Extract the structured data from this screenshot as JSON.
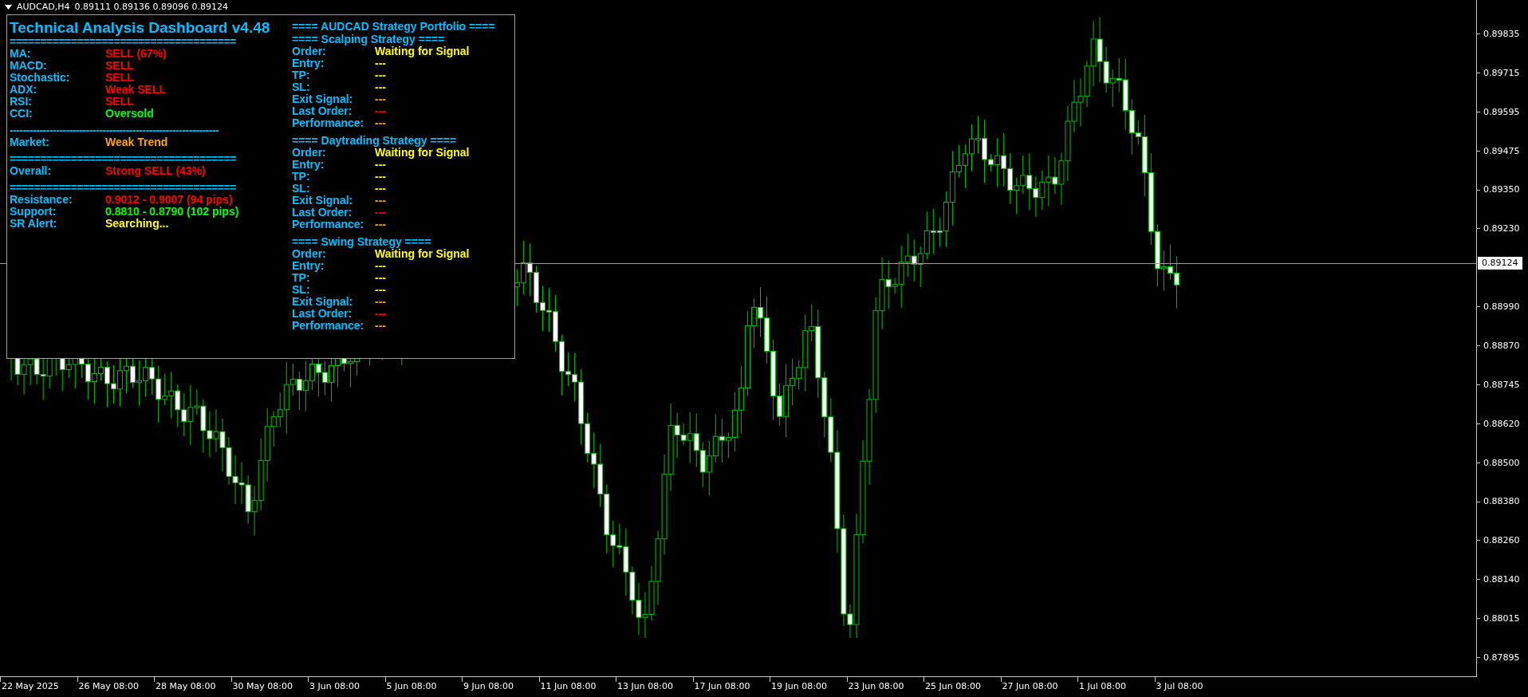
{
  "chart": {
    "header": {
      "symbol": "AUDCAD,H4",
      "quotes": "0.89111 0.89136 0.89096 0.89124"
    },
    "price_axis": [
      "0.89835",
      "0.89715",
      "0.89595",
      "0.89475",
      "0.89350",
      "0.89230",
      "0.88990",
      "0.88870",
      "0.88745",
      "0.88620",
      "0.88500",
      "0.88380",
      "0.88260",
      "0.88140",
      "0.88015",
      "0.87895"
    ],
    "current_price": "0.89124",
    "time_axis": [
      "22 May 2025",
      "26 May 08:00",
      "28 May 08:00",
      "30 May 08:00",
      "3 Jun 08:00",
      "5 Jun 08:00",
      "9 Jun 08:00",
      "11 Jun 08:00",
      "13 Jun 08:00",
      "17 Jun 08:00",
      "19 Jun 08:00",
      "23 Jun 08:00",
      "25 Jun 08:00",
      "27 Jun 08:00",
      "1 Jul 08:00",
      "3 Jul 08:00"
    ]
  },
  "dashboard": {
    "title": "Technical Analysis Dashboard v4.48",
    "lines": [
      {
        "kind": "separator",
        "text": "====================================="
      },
      {
        "kind": "row",
        "label": "MA:",
        "value": "SELL (67%)",
        "color": "#ff0000"
      },
      {
        "kind": "row",
        "label": "MACD:",
        "value": "SELL",
        "color": "#ff0000"
      },
      {
        "kind": "row",
        "label": "Stochastic:",
        "value": "SELL",
        "color": "#ff0000"
      },
      {
        "kind": "row",
        "label": "ADX:",
        "value": "Weak SELL",
        "color": "#ff0000"
      },
      {
        "kind": "row",
        "label": "RSI:",
        "value": "SELL",
        "color": "#ff0000"
      },
      {
        "kind": "row",
        "label": "CCI:",
        "value": "Oversold",
        "color": "#00ff00"
      },
      {
        "kind": "separator",
        "text": "---------------------------------------------------------------"
      },
      {
        "kind": "row",
        "label": "Market:",
        "value": "Weak Trend",
        "color": "#ffa500"
      },
      {
        "kind": "separator",
        "text": "====================================="
      },
      {
        "kind": "row",
        "label": "Overall:",
        "value": "Strong SELL (43%)",
        "color": "#ff0000"
      },
      {
        "kind": "separator",
        "text": "====================================="
      },
      {
        "kind": "row",
        "label": "Resistance:",
        "value": "0.9012 - 0.9007 (94 pips)",
        "color": "#ff0000"
      },
      {
        "kind": "row",
        "label": "Support:",
        "value": "0.8810 - 0.8790 (102 pips)",
        "color": "#00ff00"
      },
      {
        "kind": "row",
        "label": "SR Alert:",
        "value": "Searching...",
        "color": "#ffff00"
      }
    ]
  },
  "portfolio": {
    "title": "==== AUDCAD Strategy Portfolio ====",
    "strategies": [
      {
        "title": "==== Scalping Strategy ====",
        "rows": [
          {
            "label": "Order:",
            "value": "Waiting for Signal",
            "color": "#ffff00"
          },
          {
            "label": "Entry:",
            "value": "---",
            "color": "#ffff00"
          },
          {
            "label": "TP:",
            "value": "---",
            "color": "#ffff00"
          },
          {
            "label": "SL:",
            "value": "---",
            "color": "#ffff00"
          },
          {
            "label": "Exit Signal:",
            "value": "---",
            "color": "#ffa500"
          },
          {
            "label": "Last Order:",
            "value": "---",
            "color": "#ff0000"
          },
          {
            "label": "Performance:",
            "value": "---",
            "color": "#ffa500"
          }
        ]
      },
      {
        "title": "==== Daytrading Strategy ====",
        "rows": [
          {
            "label": "Order:",
            "value": "Waiting for Signal",
            "color": "#ffff00"
          },
          {
            "label": "Entry:",
            "value": "---",
            "color": "#ffff00"
          },
          {
            "label": "TP:",
            "value": "---",
            "color": "#ffff00"
          },
          {
            "label": "SL:",
            "value": "---",
            "color": "#ffff00"
          },
          {
            "label": "Exit Signal:",
            "value": "---",
            "color": "#ffa500"
          },
          {
            "label": "Last Order:",
            "value": "---",
            "color": "#ff0000"
          },
          {
            "label": "Performance:",
            "value": "---",
            "color": "#ffa500"
          }
        ]
      },
      {
        "title": "==== Swing Strategy ====",
        "rows": [
          {
            "label": "Order:",
            "value": "Waiting for Signal",
            "color": "#ffff00"
          },
          {
            "label": "Entry:",
            "value": "---",
            "color": "#ffff00"
          },
          {
            "label": "TP:",
            "value": "---",
            "color": "#ffff00"
          },
          {
            "label": "SL:",
            "value": "---",
            "color": "#ffff00"
          },
          {
            "label": "Exit Signal:",
            "value": "---",
            "color": "#ffa500"
          },
          {
            "label": "Last Order:",
            "value": "---",
            "color": "#ff0000"
          },
          {
            "label": "Performance:",
            "value": "---",
            "color": "#ffa500"
          }
        ]
      }
    ]
  }
}
